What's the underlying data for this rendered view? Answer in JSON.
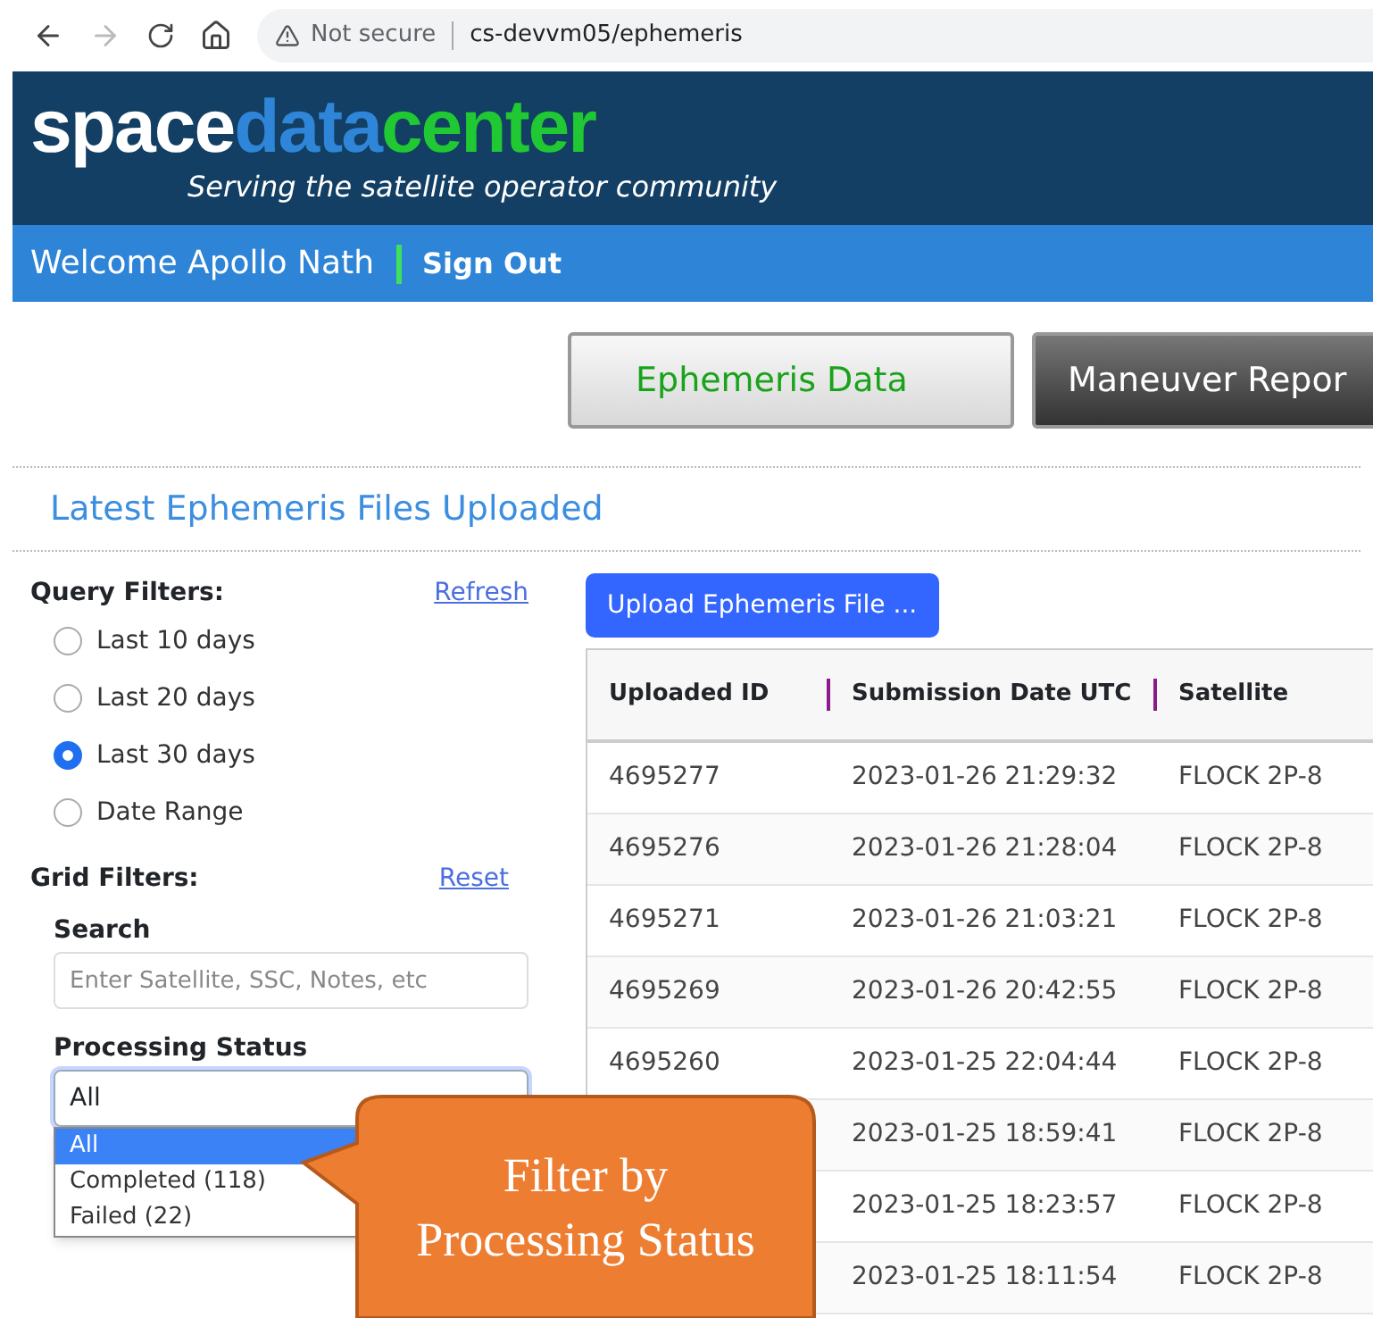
{
  "browser": {
    "security": "Not secure",
    "url": "cs-devvm05/ephemeris"
  },
  "logo": {
    "parts": [
      "space",
      "data",
      "center"
    ],
    "tagline": "Serving the satellite operator community"
  },
  "nav": {
    "welcome": "Welcome Apollo Nath",
    "sign_out": "Sign Out"
  },
  "tabs": [
    {
      "label": "Ephemeris Data",
      "selected": true
    },
    {
      "label": "Maneuver Repor",
      "selected": false
    }
  ],
  "heading": "Latest Ephemeris Files Uploaded",
  "query_filters": {
    "title": "Query Filters:",
    "link": "Refresh",
    "options": [
      {
        "label": "Last 10 days",
        "selected": false
      },
      {
        "label": "Last 20 days",
        "selected": false
      },
      {
        "label": "Last 30 days",
        "selected": true
      },
      {
        "label": "Date Range",
        "selected": false
      }
    ]
  },
  "grid_filters": {
    "title": "Grid Filters:",
    "link": "Reset",
    "search_label": "Search",
    "search": {
      "placeholder": "Enter Satellite, SSC, Notes, etc"
    },
    "status_label": "Processing Status",
    "status_value": "All",
    "dropdown": [
      {
        "label": "All",
        "selected": true
      },
      {
        "label": "Completed (118)",
        "selected": false
      },
      {
        "label": "Failed (22)",
        "selected": false
      }
    ]
  },
  "upload_button": "Upload Ephemeris File ...",
  "table": {
    "columns": [
      "Uploaded ID",
      "Submission Date UTC",
      "Satellite"
    ],
    "rows": [
      {
        "id": "4695277",
        "date": "2023-01-26 21:29:32",
        "satellite": "FLOCK 2P-8"
      },
      {
        "id": "4695276",
        "date": "2023-01-26 21:28:04",
        "satellite": "FLOCK 2P-8"
      },
      {
        "id": "4695271",
        "date": "2023-01-26 21:03:21",
        "satellite": "FLOCK 2P-8"
      },
      {
        "id": "4695269",
        "date": "2023-01-26 20:42:55",
        "satellite": "FLOCK 2P-8"
      },
      {
        "id": "4695260",
        "date": "2023-01-25 22:04:44",
        "satellite": "FLOCK 2P-8"
      },
      {
        "date": "2023-01-25 18:59:41",
        "satellite": "FLOCK 2P-8"
      },
      {
        "date": "2023-01-25 18:23:57",
        "satellite": "FLOCK 2P-8"
      },
      {
        "date": "2023-01-25 18:11:54",
        "satellite": "FLOCK 2P-8"
      }
    ]
  },
  "callout": {
    "lines": [
      "Filter by",
      "Processing Status"
    ]
  }
}
